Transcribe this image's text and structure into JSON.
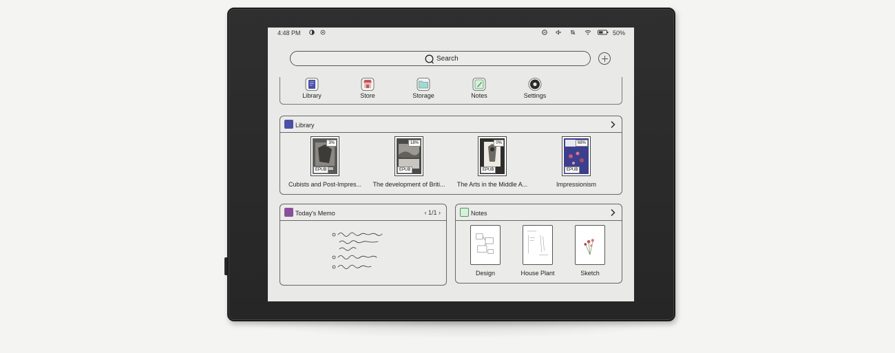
{
  "status_bar": {
    "time": "4:48 PM",
    "battery": "50%",
    "icons": [
      "theme-icon",
      "sync-icon",
      "dnd-icon",
      "volume-mute-icon",
      "notification-off-icon",
      "wifi-icon",
      "battery-icon"
    ]
  },
  "search": {
    "label": "Search"
  },
  "dock": {
    "apps": [
      {
        "label": "Library",
        "icon": "library-icon",
        "color": "#4b4fa6"
      },
      {
        "label": "Store",
        "icon": "store-icon",
        "color": "#c0585a"
      },
      {
        "label": "Storage",
        "icon": "folder-icon",
        "color": "#5aa39b"
      },
      {
        "label": "Notes",
        "icon": "notes-icon",
        "color": "#4a9a5a"
      },
      {
        "label": "Settings",
        "icon": "settings-icon",
        "color": "#333333"
      }
    ]
  },
  "library": {
    "title": "Library",
    "books": [
      {
        "title": "Cubists and Post-Impres...",
        "progress": "3%",
        "format": "EPUB"
      },
      {
        "title": "The development of Briti...",
        "progress": "18%",
        "format": "EPUB"
      },
      {
        "title": "The Arts in the Middle A...",
        "progress": "0%",
        "format": "EPUB"
      },
      {
        "title": "Impressionism",
        "progress": "68%",
        "format": "EPUB"
      }
    ]
  },
  "memo": {
    "title": "Today's Memo",
    "pager": "1/1"
  },
  "notes": {
    "title": "Notes",
    "items": [
      {
        "label": "Design"
      },
      {
        "label": "House Plant"
      },
      {
        "label": "Sketch"
      }
    ]
  },
  "colors": {
    "library_accent": "#4b4fa6",
    "memo_accent": "#8a4f9a",
    "notes_accent": "#4a9a5a"
  }
}
